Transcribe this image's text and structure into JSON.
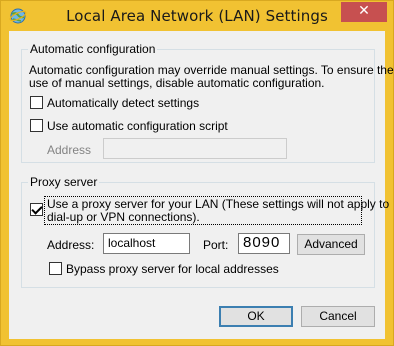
{
  "window": {
    "title": "Local Area Network (LAN) Settings",
    "close_glyph": "✕",
    "colors": {
      "title_bar": "#f1c232",
      "close_button": "#c75050",
      "dialog_bg": "#f0f0f0",
      "group_border": "#d5dfe5"
    }
  },
  "automatic_configuration": {
    "legend": "Automatic configuration",
    "description_line1": "Automatic configuration may override manual settings.  To ensure the",
    "description_line2": "use of manual settings, disable automatic configuration.",
    "auto_detect": {
      "label": "Automatically detect settings",
      "checked": false
    },
    "use_script": {
      "label": "Use automatic configuration script",
      "checked": false
    },
    "address_label": "Address",
    "address_value": ""
  },
  "proxy_server": {
    "legend": "Proxy server",
    "use_proxy": {
      "label_line1": "Use a proxy server for your LAN (These settings will not apply to",
      "label_line2": "dial-up or VPN connections).",
      "checked": true
    },
    "address_label": "Address:",
    "address_value": "localhost",
    "port_label": "Port:",
    "port_value": "8090",
    "advanced_button": "Advanced",
    "bypass_local": {
      "label": "Bypass proxy server for local addresses",
      "checked": false
    }
  },
  "buttons": {
    "ok": "OK",
    "cancel": "Cancel"
  }
}
